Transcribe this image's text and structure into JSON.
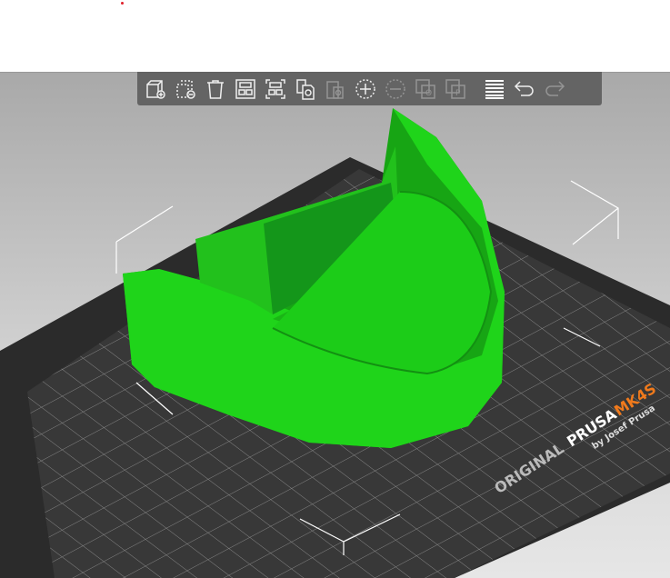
{
  "toolbar": {
    "items": [
      {
        "name": "add",
        "icon": "add-object-icon",
        "enabled": true
      },
      {
        "name": "delete",
        "icon": "delete-object-icon",
        "enabled": true
      },
      {
        "name": "delete-all",
        "icon": "trash-icon",
        "enabled": true
      },
      {
        "name": "arrange",
        "icon": "arrange-icon",
        "enabled": true
      },
      {
        "name": "arrange-selection",
        "icon": "arrange-selection-icon",
        "enabled": true
      },
      {
        "name": "copy",
        "icon": "copy-icon",
        "enabled": true
      },
      {
        "name": "paste",
        "icon": "paste-icon",
        "enabled": false
      },
      {
        "name": "add-instance",
        "icon": "add-instance-icon",
        "enabled": true
      },
      {
        "name": "remove-instance",
        "icon": "remove-instance-icon",
        "enabled": false
      },
      {
        "name": "split-objects",
        "icon": "split-objects-icon",
        "enabled": false
      },
      {
        "name": "split-parts",
        "icon": "split-parts-icon",
        "enabled": false
      },
      {
        "name": "layers",
        "icon": "layers-editing-icon",
        "enabled": true
      },
      {
        "name": "undo",
        "icon": "undo-icon",
        "enabled": true
      },
      {
        "name": "redo",
        "icon": "redo-icon",
        "enabled": false
      }
    ]
  },
  "bed": {
    "brand_prefix": "ORIGINAL",
    "brand": "PRUSA",
    "model": "MK4S",
    "byline": "by Josef Prusa"
  },
  "colors": {
    "model": "#1fd41a",
    "model_dark": "#17a514",
    "bed": "#2e2e2e",
    "accent": "#f07a1c",
    "toolbar": "#5a5a5a"
  }
}
